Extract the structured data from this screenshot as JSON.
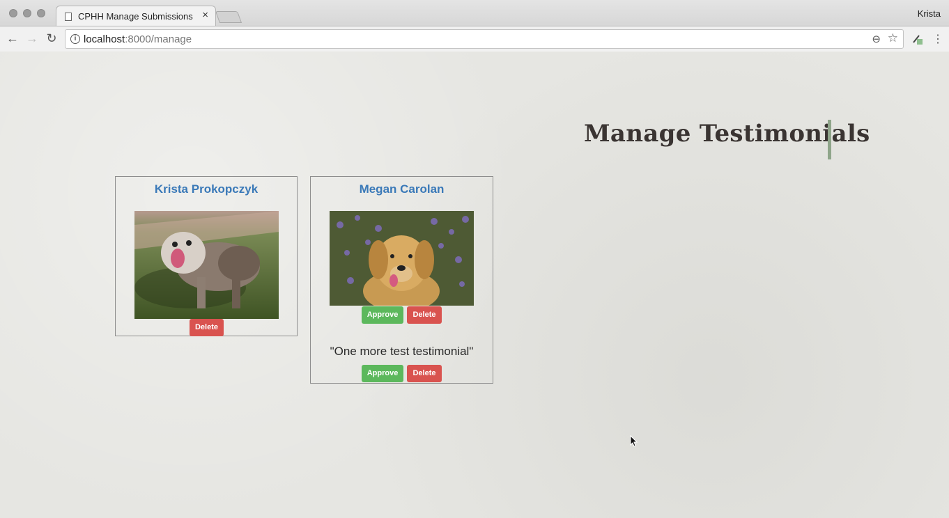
{
  "browser": {
    "tab_title": "CPHH Manage Submissions",
    "tab_close": "×",
    "profile_name": "Krista",
    "url_host": "localhost",
    "url_rest": ":8000/manage",
    "back": "←",
    "forward": "→",
    "reload": "↻",
    "info": "i",
    "zoom": "⊖",
    "star": "☆",
    "menu": "⋮"
  },
  "page": {
    "heading": "Manage Testimonials",
    "accent_color": "#8fa58a"
  },
  "cards": [
    {
      "name": "Krista Prokopczyk",
      "photo": "bulldog-photo",
      "delete_label": "Delete"
    },
    {
      "name": "Megan Carolan",
      "photo": "golden-retriever-photo",
      "approve_label": "Approve",
      "delete_label": "Delete",
      "testimonial": "\"One more test testimonial\"",
      "approve_label_2": "Approve",
      "delete_label_2": "Delete"
    }
  ],
  "colors": {
    "approve": "#5cb85c",
    "delete": "#d9534f",
    "name": "#3a79b8"
  }
}
